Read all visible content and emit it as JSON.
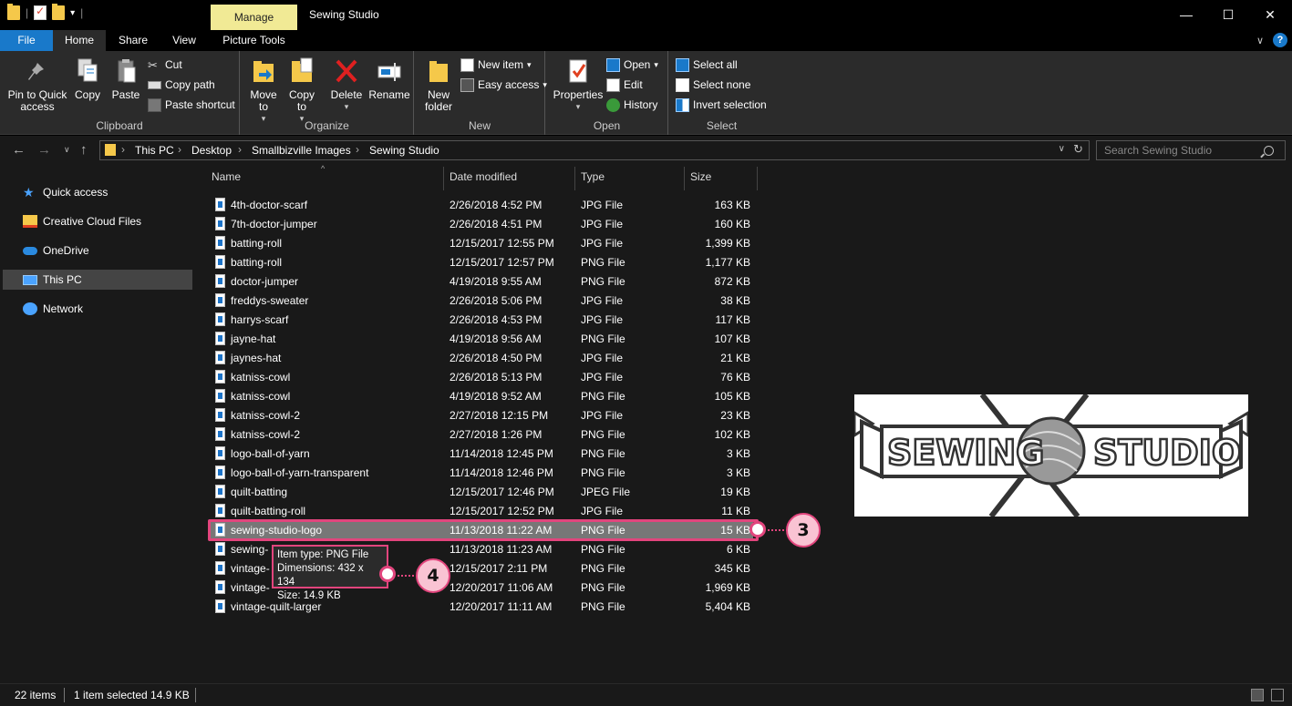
{
  "window": {
    "title": "Sewing Studio",
    "context_tab": "Manage",
    "minimize": "—",
    "maximize": "☐",
    "close": "✕"
  },
  "tabs": [
    {
      "label": "File"
    },
    {
      "label": "Home"
    },
    {
      "label": "Share"
    },
    {
      "label": "View"
    },
    {
      "label": "Picture Tools"
    }
  ],
  "ribbon": {
    "clipboard": {
      "label": "Clipboard",
      "pin": "Pin to Quick access",
      "copy": "Copy",
      "paste": "Paste",
      "cut": "Cut",
      "copy_path": "Copy path",
      "paste_shortcut": "Paste shortcut"
    },
    "organize": {
      "label": "Organize",
      "move_to": "Move to",
      "copy_to": "Copy to",
      "delete": "Delete",
      "rename": "Rename"
    },
    "new": {
      "label": "New",
      "new_folder": "New folder",
      "new_item": "New item",
      "easy_access": "Easy access"
    },
    "open": {
      "label": "Open",
      "properties": "Properties",
      "open": "Open",
      "edit": "Edit",
      "history": "History"
    },
    "select": {
      "label": "Select",
      "select_all": "Select all",
      "select_none": "Select none",
      "invert_selection": "Invert selection"
    }
  },
  "address": {
    "crumbs": [
      "This PC",
      "Desktop",
      "Smallbizville Images",
      "Sewing Studio"
    ],
    "search_placeholder": "Search Sewing Studio"
  },
  "nav": [
    {
      "label": "Quick access"
    },
    {
      "label": "Creative Cloud Files"
    },
    {
      "label": "OneDrive"
    },
    {
      "label": "This PC"
    },
    {
      "label": "Network"
    }
  ],
  "columns": {
    "name": "Name",
    "date": "Date modified",
    "type": "Type",
    "size": "Size"
  },
  "files": [
    {
      "name": "4th-doctor-scarf",
      "date": "2/26/2018 4:52 PM",
      "type": "JPG File",
      "size": "163 KB"
    },
    {
      "name": "7th-doctor-jumper",
      "date": "2/26/2018 4:51 PM",
      "type": "JPG File",
      "size": "160 KB"
    },
    {
      "name": "batting-roll",
      "date": "12/15/2017 12:55 PM",
      "type": "JPG File",
      "size": "1,399 KB"
    },
    {
      "name": "batting-roll",
      "date": "12/15/2017 12:57 PM",
      "type": "PNG File",
      "size": "1,177 KB"
    },
    {
      "name": "doctor-jumper",
      "date": "4/19/2018 9:55 AM",
      "type": "PNG File",
      "size": "872 KB"
    },
    {
      "name": "freddys-sweater",
      "date": "2/26/2018 5:06 PM",
      "type": "JPG File",
      "size": "38 KB"
    },
    {
      "name": "harrys-scarf",
      "date": "2/26/2018 4:53 PM",
      "type": "JPG File",
      "size": "117 KB"
    },
    {
      "name": "jayne-hat",
      "date": "4/19/2018 9:56 AM",
      "type": "PNG File",
      "size": "107 KB"
    },
    {
      "name": "jaynes-hat",
      "date": "2/26/2018 4:50 PM",
      "type": "JPG File",
      "size": "21 KB"
    },
    {
      "name": "katniss-cowl",
      "date": "2/26/2018 5:13 PM",
      "type": "JPG File",
      "size": "76 KB"
    },
    {
      "name": "katniss-cowl",
      "date": "4/19/2018 9:52 AM",
      "type": "PNG File",
      "size": "105 KB"
    },
    {
      "name": "katniss-cowl-2",
      "date": "2/27/2018 12:15 PM",
      "type": "JPG File",
      "size": "23 KB"
    },
    {
      "name": "katniss-cowl-2",
      "date": "2/27/2018 1:26 PM",
      "type": "PNG File",
      "size": "102 KB"
    },
    {
      "name": "logo-ball-of-yarn",
      "date": "11/14/2018 12:45 PM",
      "type": "PNG File",
      "size": "3 KB"
    },
    {
      "name": "logo-ball-of-yarn-transparent",
      "date": "11/14/2018 12:46 PM",
      "type": "PNG File",
      "size": "3 KB"
    },
    {
      "name": "quilt-batting",
      "date": "12/15/2017 12:46 PM",
      "type": "JPEG File",
      "size": "19 KB"
    },
    {
      "name": "quilt-batting-roll",
      "date": "12/15/2017 12:52 PM",
      "type": "JPG File",
      "size": "11 KB"
    },
    {
      "name": "sewing-studio-logo",
      "date": "11/13/2018 11:22 AM",
      "type": "PNG File",
      "size": "15 KB"
    },
    {
      "name": "sewing-",
      "date": "11/13/2018 11:23 AM",
      "type": "PNG File",
      "size": "6 KB"
    },
    {
      "name": "vintage-",
      "date": "12/15/2017 2:11 PM",
      "type": "PNG File",
      "size": "345 KB"
    },
    {
      "name": "vintage-",
      "date": "12/20/2017 11:06 AM",
      "type": "PNG File",
      "size": "1,969 KB"
    },
    {
      "name": "vintage-quilt-larger",
      "date": "12/20/2017 11:11 AM",
      "type": "PNG File",
      "size": "5,404 KB"
    }
  ],
  "tooltip": {
    "type": "Item type: PNG File",
    "dimensions": "Dimensions: 432 x 134",
    "size": "Size: 14.9 KB"
  },
  "preview": {
    "left": "SEWING",
    "right": "STUDIO"
  },
  "status": {
    "items": "22 items",
    "selected": "1 item selected  14.9 KB"
  },
  "callouts": {
    "row": "3",
    "tooltip": "4"
  },
  "colors": {
    "accent": "#1979ca",
    "highlight": "#e2457d",
    "manage": "#f1ea95"
  }
}
